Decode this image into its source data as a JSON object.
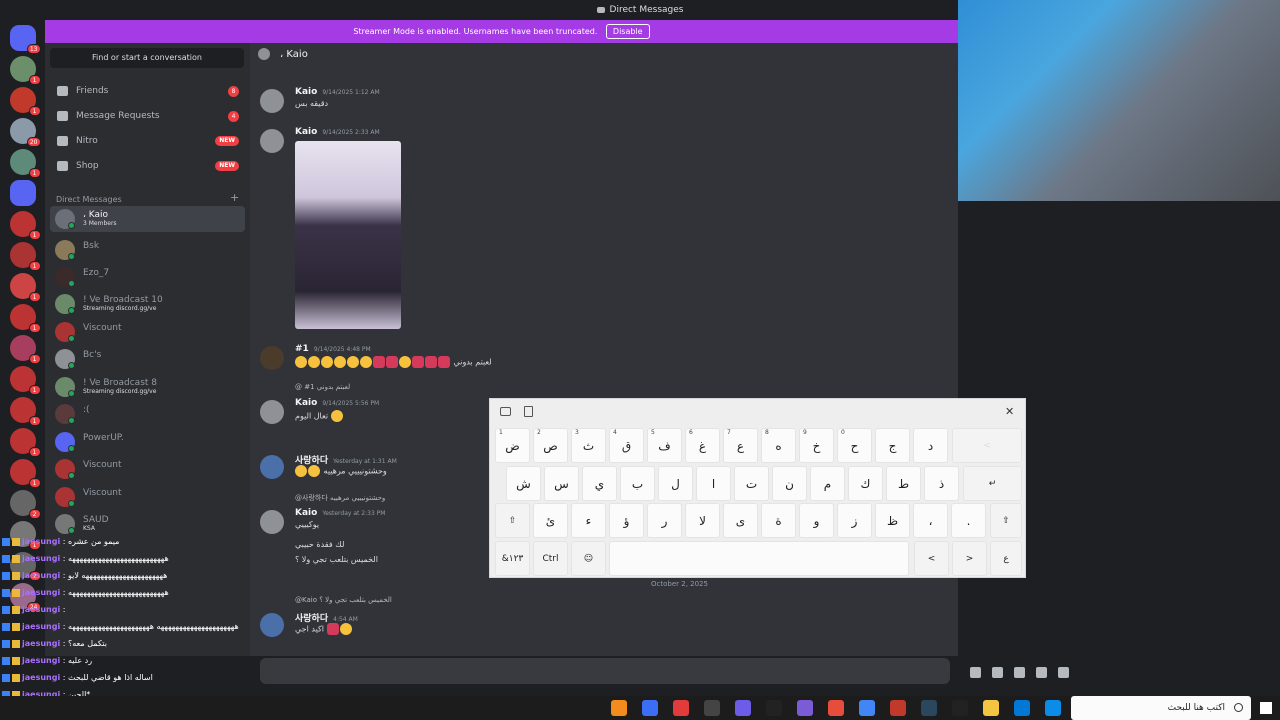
{
  "window": {
    "title": "Direct Messages"
  },
  "banner": {
    "text": "Streamer Mode is enabled. Usernames have been truncated.",
    "button": "Disable"
  },
  "sidebar": {
    "search_placeholder": "Find or start a conversation",
    "nav": [
      {
        "label": "Friends",
        "badge": "8"
      },
      {
        "label": "Message Requests",
        "badge": "4"
      },
      {
        "label": "Nitro",
        "badge": "NEW"
      },
      {
        "label": "Shop",
        "badge": "NEW"
      }
    ],
    "dm_header": "Direct Messages",
    "dm_add": "+",
    "dms": [
      {
        "name": "، Kaio",
        "sub": "3 Members"
      },
      {
        "name": "Bsk",
        "sub": ""
      },
      {
        "name": "Ezo_7",
        "sub": ""
      },
      {
        "name": "! Ve Broadcast 10",
        "sub": "Streaming discord.gg/ve"
      },
      {
        "name": "Viscount",
        "sub": ""
      },
      {
        "name": "Bc's",
        "sub": ""
      },
      {
        "name": "! Ve Broadcast 8",
        "sub": "Streaming discord.gg/ve"
      },
      {
        "name": ":(",
        "sub": ""
      },
      {
        "name": "PowerUP.",
        "sub": ""
      },
      {
        "name": "Viscount",
        "sub": ""
      },
      {
        "name": "Viscount",
        "sub": ""
      },
      {
        "name": "SAUD",
        "sub": "KSA"
      }
    ]
  },
  "servers": {
    "badges": [
      "13",
      "1",
      "1",
      "20",
      "1",
      "",
      "1",
      "1",
      "1",
      "1",
      "1",
      "1",
      "1",
      "1",
      "1",
      "2",
      "1",
      "2",
      "24"
    ]
  },
  "chat": {
    "header": "، Kaio",
    "messages": [
      {
        "author": "Kaio",
        "time": "9/14/2025 1:12 AM",
        "text": "دقيقه بس"
      },
      {
        "author": "Kaio",
        "time": "9/14/2025 2:33 AM",
        "text": ""
      },
      {
        "author": "#1",
        "time": "9/14/2025 4:48 PM",
        "text": "لعبتم بدوني"
      },
      {
        "author": "Kaio",
        "time": "9/14/2025 5:56 PM",
        "text": "تعال اليوم"
      },
      {
        "author": "사랑하다",
        "time": "Yesterday at 1:31 AM",
        "text": "وحشتونيييي مرهييه"
      },
      {
        "author": "Kaio",
        "time": "Yesterday at 2:33 PM",
        "text": "يوكيييي"
      },
      {
        "author": "사랑하다",
        "time": "4:54 AM",
        "text": "اكيد اجي"
      }
    ],
    "reply_1": "@ #1 لعبتم بدوني",
    "reply_2": "@사랑하다 وحشتونيييي مرهييه",
    "line_2a": "لك فقدة حبيبي",
    "line_2b": "الخميس بتلعب تجي ولا ؟",
    "reply_3": "@Kaio الخميس بتلعب تجي ولا ؟",
    "date_divider": "October 2, 2025"
  },
  "keyboard": {
    "row1": [
      {
        "k": "ض",
        "n": "1"
      },
      {
        "k": "ص",
        "n": "2"
      },
      {
        "k": "ث",
        "n": "3"
      },
      {
        "k": "ق",
        "n": "4"
      },
      {
        "k": "ف",
        "n": "5"
      },
      {
        "k": "غ",
        "n": "6"
      },
      {
        "k": "ع",
        "n": "7"
      },
      {
        "k": "ه",
        "n": "8"
      },
      {
        "k": "خ",
        "n": "9"
      },
      {
        "k": "ح",
        "n": "0"
      },
      {
        "k": "ج",
        "n": ""
      },
      {
        "k": "د",
        "n": ""
      }
    ],
    "row2": [
      "ش",
      "س",
      "ي",
      "ب",
      "ل",
      "ا",
      "ت",
      "ن",
      "م",
      "ك",
      "ط",
      "ذ"
    ],
    "row3": [
      "ئ",
      "ء",
      "ؤ",
      "ر",
      "لا",
      "ى",
      "ة",
      "و",
      "ز",
      "ظ",
      "،",
      "."
    ],
    "bottom": {
      "numbers": "&١٢٣",
      "ctrl": "Ctrl",
      "lang": "ع"
    },
    "icons": {
      "close": "✕",
      "enter": "↵",
      "shift": "⇧",
      "left": "<",
      "right": ">",
      "emoji": "☺"
    }
  },
  "chat_overlay": [
    {
      "user": "jaesungi",
      "text": "ميمو من عشره"
    },
    {
      "user": "jaesungi",
      "text": "ههههههههههههههههههههههههههه"
    },
    {
      "user": "jaesungi",
      "text": "ههههههههههههههههههههههه لايو"
    },
    {
      "user": "jaesungi",
      "text": "ههههههههههههههههههههههههههه"
    },
    {
      "user": "jaesungi",
      "text": ""
    },
    {
      "user": "jaesungi",
      "text": "هههههههههههههههههههههه ههههههههههههههههههههههه"
    },
    {
      "user": "jaesungi",
      "text": "بتكمل معه؟"
    },
    {
      "user": "jaesungi",
      "text": "رد عليه"
    },
    {
      "user": "jaesungi",
      "text": "اساله اذا هو قاضي للبحث"
    },
    {
      "user": "jaesungi",
      "text": "الحين*"
    },
    {
      "user": "jaesungi",
      "text": ""
    }
  ],
  "taskbar": {
    "search_placeholder": "اكتب هنا للبحث"
  }
}
